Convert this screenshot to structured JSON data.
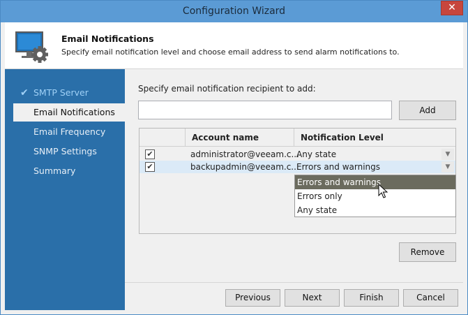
{
  "window": {
    "title": "Configuration Wizard",
    "close_glyph": "✕"
  },
  "header": {
    "title": "Email Notifications",
    "description": "Specify email notification level and choose email address to send alarm notifications to.",
    "icon": "monitor-gear-icon"
  },
  "sidebar": {
    "items": [
      {
        "label": "SMTP Server",
        "state": "done"
      },
      {
        "label": "Email Notifications",
        "state": "active"
      },
      {
        "label": "Email Frequency",
        "state": "pending"
      },
      {
        "label": "SNMP Settings",
        "state": "pending"
      },
      {
        "label": "Summary",
        "state": "pending"
      }
    ]
  },
  "content": {
    "prompt": "Specify email notification recipient to add:",
    "email_input": {
      "value": "",
      "placeholder": ""
    },
    "add_label": "Add",
    "remove_label": "Remove",
    "grid": {
      "columns": [
        "",
        "Account name",
        "Notification Level"
      ],
      "rows": [
        {
          "checked": true,
          "account": "administrator@veeam.c...",
          "level": "Any state"
        },
        {
          "checked": true,
          "account": "backupadmin@veeam.c...",
          "level": "Errors and warnings"
        }
      ]
    },
    "dropdown": {
      "options": [
        "Errors and warnings",
        "Errors only",
        "Any state"
      ],
      "highlighted_index": 0
    }
  },
  "footer": {
    "previous": "Previous",
    "next": "Next",
    "finish": "Finish",
    "cancel": "Cancel"
  },
  "colors": {
    "titlebar": "#5b9bd5",
    "sidebar": "#2a6fa9",
    "close": "#c7463d",
    "highlight": "#6b6b5e"
  }
}
